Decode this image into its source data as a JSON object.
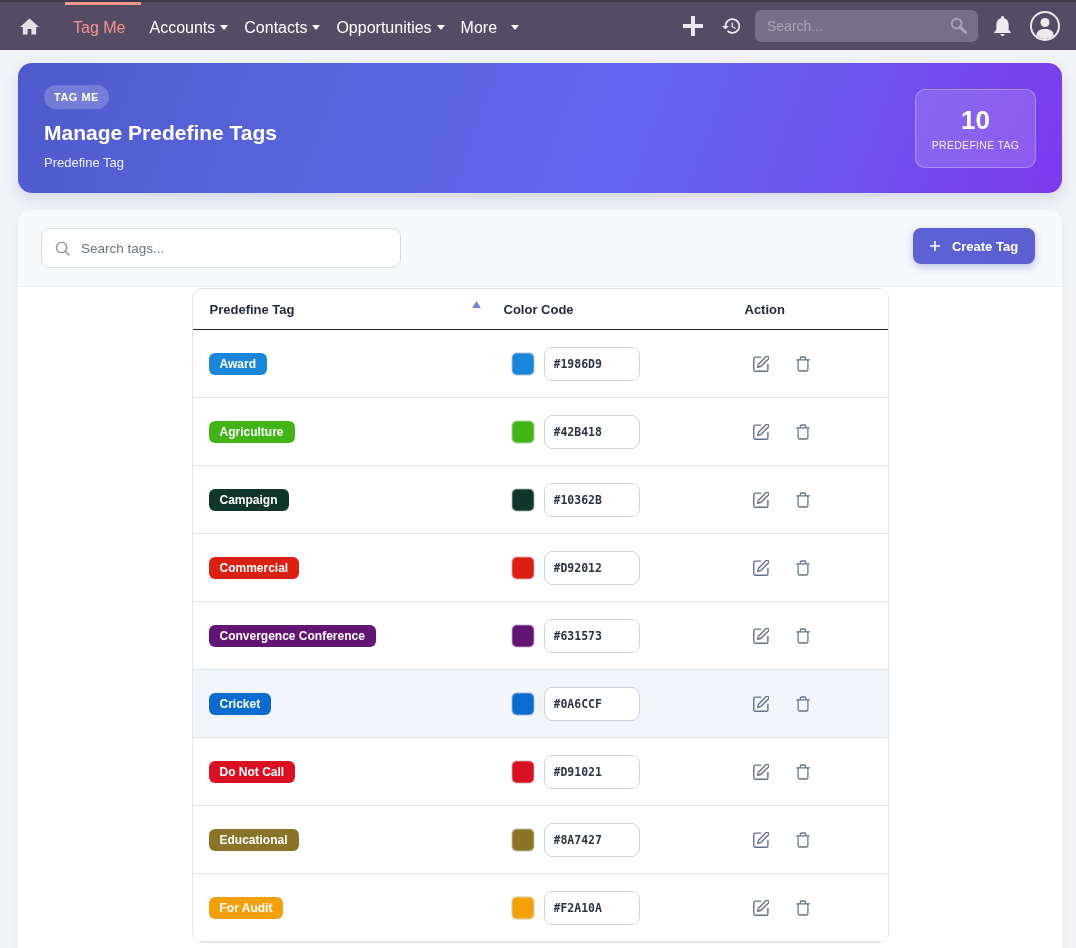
{
  "navbar": {
    "items": [
      {
        "label": "Tag Me",
        "selected": true,
        "dropdown": false
      },
      {
        "label": "Accounts",
        "selected": false,
        "dropdown": true
      },
      {
        "label": "Contacts",
        "selected": false,
        "dropdown": true
      },
      {
        "label": "Opportunities",
        "selected": false,
        "dropdown": true
      },
      {
        "label": "More",
        "selected": false,
        "dropdown": true
      }
    ],
    "search": {
      "placeholder": "Search..."
    }
  },
  "header": {
    "badge": "TAG ME",
    "title": "Manage Predefine Tags",
    "subtitle": "Predefine Tag",
    "stat": {
      "value": "10",
      "label": "PREDEFINE TAG"
    }
  },
  "toolbar": {
    "search": {
      "placeholder": "Search tags..."
    },
    "create_button": "Create Tag"
  },
  "table": {
    "columns": [
      {
        "label": "Predefine Tag",
        "sorted": true
      },
      {
        "label": "Color Code",
        "sorted": false
      },
      {
        "label": "Action",
        "sorted": false
      }
    ],
    "rows": [
      {
        "tag": "Award",
        "color": "#1986d9",
        "code": "#1986D9",
        "hovered": false
      },
      {
        "tag": "Agriculture",
        "color": "#42b418",
        "code": "#42B418",
        "hovered": false
      },
      {
        "tag": "Campaign",
        "color": "#10362b",
        "code": "#10362B",
        "hovered": false
      },
      {
        "tag": "Commercial",
        "color": "#d92012",
        "code": "#D92012",
        "hovered": false
      },
      {
        "tag": "Convergence Conference",
        "color": "#631573",
        "code": "#631573",
        "hovered": false
      },
      {
        "tag": "Cricket",
        "color": "#0a6ccf",
        "code": "#0A6CCF",
        "hovered": true
      },
      {
        "tag": "Do Not Call",
        "color": "#d91021",
        "code": "#D91021",
        "hovered": false
      },
      {
        "tag": "Educational",
        "color": "#8a7427",
        "code": "#8A7427",
        "hovered": false
      },
      {
        "tag": "For Audit",
        "color": "#f2a10a",
        "code": "#F2A10A",
        "hovered": false
      }
    ]
  }
}
